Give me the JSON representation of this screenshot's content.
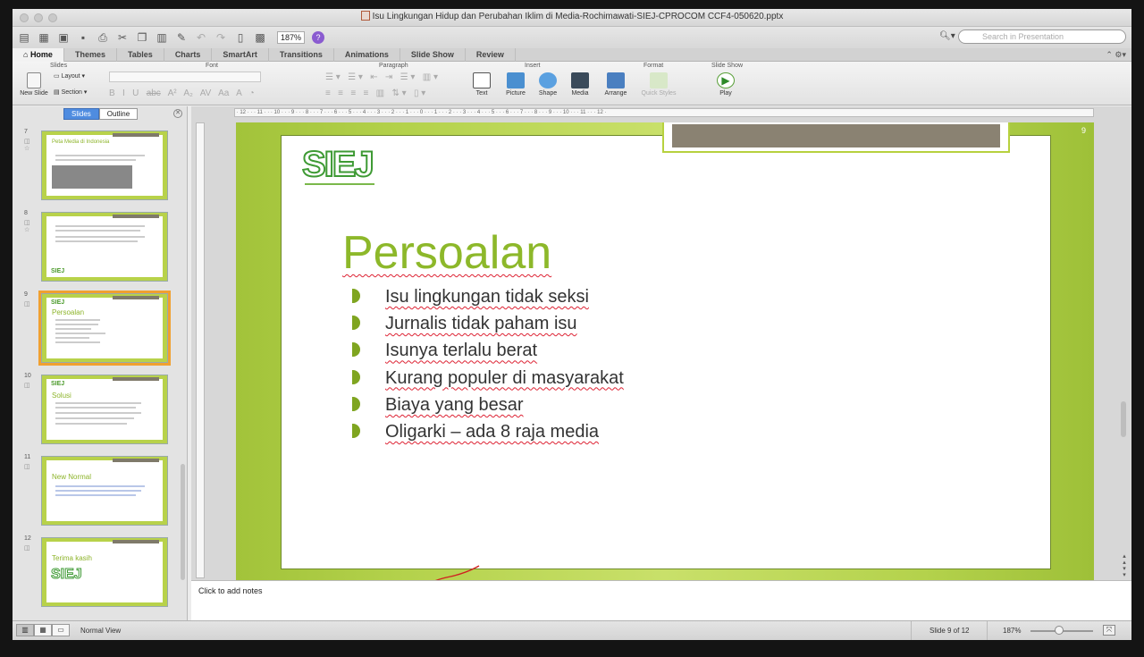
{
  "window": {
    "title": "Isu Lingkungan Hidup dan Perubahan Iklim di Media-Rochimawati-SIEJ-CPROCOM CCF4-050620.pptx"
  },
  "toolbar": {
    "zoom": "187%",
    "search_placeholder": "Search in Presentation",
    "help": "?"
  },
  "tabs": [
    "Home",
    "Themes",
    "Tables",
    "Charts",
    "SmartArt",
    "Transitions",
    "Animations",
    "Slide Show",
    "Review"
  ],
  "ribbon": {
    "groups": {
      "slides": "Slides",
      "font": "Font",
      "paragraph": "Paragraph",
      "insert": "Insert",
      "format": "Format",
      "slideshow": "Slide Show"
    },
    "new_slide": "New Slide",
    "layout": "Layout",
    "section": "Section",
    "text": "Text",
    "picture": "Picture",
    "shape": "Shape",
    "media": "Media",
    "arrange": "Arrange",
    "quick_styles": "Quick Styles",
    "play": "Play"
  },
  "panel": {
    "slides_tab": "Slides",
    "outline_tab": "Outline"
  },
  "thumbnails": [
    {
      "num": "7",
      "title": "Peta Media di Indonesia"
    },
    {
      "num": "8",
      "title": ""
    },
    {
      "num": "9",
      "title": "Persoalan"
    },
    {
      "num": "10",
      "title": "Solusi"
    },
    {
      "num": "11",
      "title": "New Normal"
    },
    {
      "num": "12",
      "title": "Terima kasih"
    }
  ],
  "slide": {
    "logo": "SIEJ",
    "title": "Persoalan",
    "page_number": "9",
    "bullets": [
      "Isu lingkungan tidak seksi",
      "Jurnalis tidak paham isu",
      "Isunya terlalu berat",
      "Kurang populer di masyarakat",
      "Biaya yang besar",
      "Oligarki – ada 8 raja media"
    ]
  },
  "notes": {
    "placeholder": "Click to add notes"
  },
  "status": {
    "view": "Normal View",
    "slide_of": "Slide 9 of 12",
    "zoom": "187%"
  },
  "colors": {
    "accent_green": "#8db82a",
    "slide_bg": "#b4d24c",
    "selection": "#f0a030"
  }
}
